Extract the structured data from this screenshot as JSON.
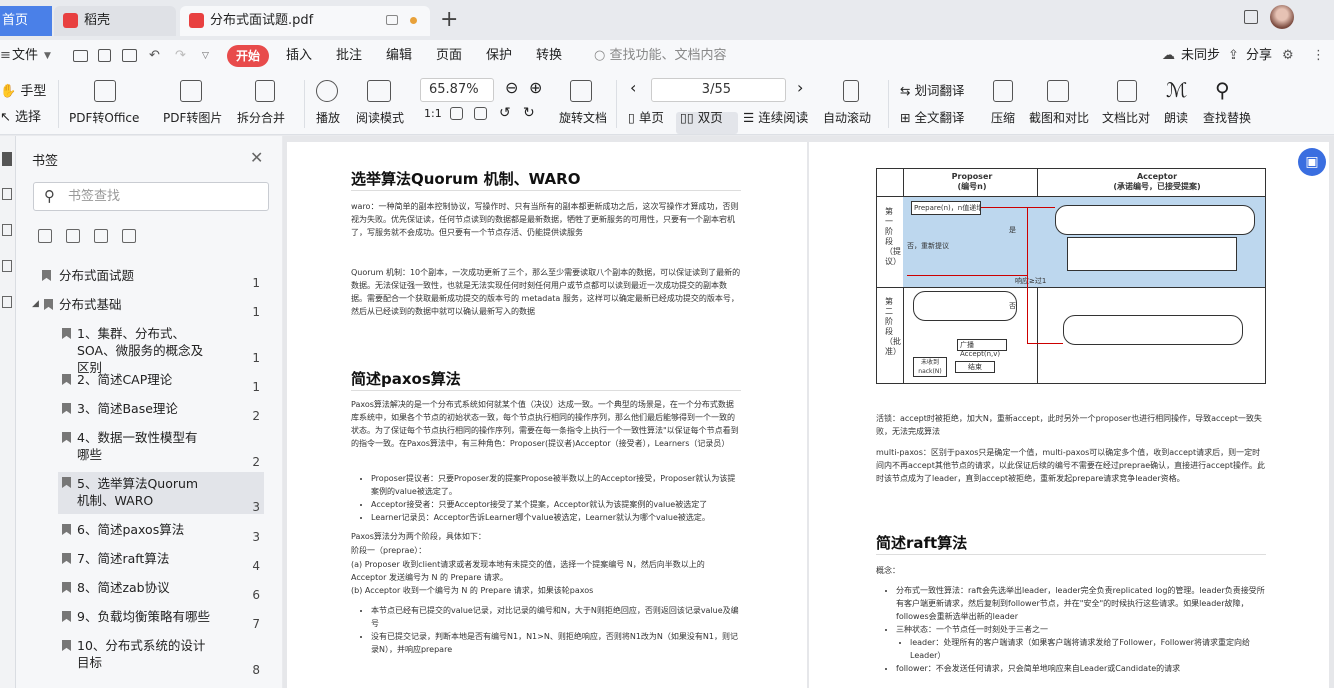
{
  "tabs": {
    "home": "首页",
    "daoke": "稻壳",
    "doc": "分布式面试题.pdf"
  },
  "menu": {
    "file": "文件",
    "start": "开始",
    "insert": "插入",
    "comment": "批注",
    "edit": "编辑",
    "page": "页面",
    "protect": "保护",
    "convert": "转换",
    "search": "查找功能、文档内容",
    "unsync": "未同步",
    "share": "分享"
  },
  "toolbar": {
    "hand": "手型",
    "select": "选择",
    "pdf2office": "PDF转Office",
    "pdf2img": "PDF转图片",
    "split": "拆分合并",
    "play": "播放",
    "readmode": "阅读模式",
    "zoom": "65.87%",
    "pageinfo": "3/55",
    "rotate": "旋转文档",
    "single": "单页",
    "dual": "双页",
    "continuous": "连续阅读",
    "autoscroll": "自动滚动",
    "wordtrans": "划词翻译",
    "fulltrans": "全文翻译",
    "compress": "压缩",
    "screenshot": "截图和对比",
    "compare": "文档比对",
    "read": "朗读",
    "findreplace": "查找替换"
  },
  "sidebar": {
    "title": "书签",
    "search_placeholder": "书签查找",
    "items": [
      {
        "label": "分布式面试题",
        "page": "1"
      },
      {
        "label": "分布式基础",
        "page": "1"
      },
      {
        "label": "1、集群、分布式、SOA、微服务的概念及区别",
        "page": "1"
      },
      {
        "label": "2、简述CAP理论",
        "page": "1"
      },
      {
        "label": "3、简述Base理论",
        "page": "2"
      },
      {
        "label": "4、数据一致性模型有哪些",
        "page": "2"
      },
      {
        "label": "5、选举算法Quorum机制、WARO",
        "page": "3"
      },
      {
        "label": "6、简述paxos算法",
        "page": "3"
      },
      {
        "label": "7、简述raft算法",
        "page": "4"
      },
      {
        "label": "8、简述zab协议",
        "page": "6"
      },
      {
        "label": "9、负载均衡策略有哪些",
        "page": "7"
      },
      {
        "label": "10、分布式系统的设计目标",
        "page": "8"
      }
    ]
  },
  "page1": {
    "h1": "选举算法Quorum 机制、WARO",
    "p1": "waro：一种简单的副本控制协议，写操作时、只有当所有的副本都更新成功之后，这次写操作才算成功，否则视为失败。优先保证读，任何节点读到的数据都是最新数据，牺牲了更新服务的可用性，只要有一个副本宕机了，写服务就不会成功。但只要有一个节点存活、仍能提供读服务",
    "p2": "Quorum 机制：10个副本，一次成功更新了三个，那么至少需要读取八个副本的数据，可以保证读到了最新的数据。无法保证强一致性，也就是无法实现任何时刻任何用户或节点都可以读到最近一次成功提交的副本数据。需要配合一个获取最新成功提交的版本号的 metadata 服务，这样可以确定最新已经成功提交的版本号，然后从已经读到的数据中就可以确认最新写入的数据",
    "h2": "简述paxos算法",
    "p3": "Paxos算法解决的是一个分布式系统如何就某个值（决议）达成一致。一个典型的场景是，在一个分布式数据库系统中，如果各个节点的初始状态一致，每个节点执行相同的操作序列，那么他们最后能够得到一个一致的状态。为了保证每个节点执行相同的操作序列，需要在每一条指令上执行一个一致性算法\"以保证每个节点看到的指令一致。在Paxos算法中，有三种角色：Proposer(提议者)Acceptor（接受者），Learners（记录员）",
    "li1": "Proposer提议者：只要Proposer发的提案Propose被半数以上的Acceptor接受，Proposer就认为该提案例的value被选定了。",
    "li2": "Acceptor接受者：只要Acceptor接受了某个提案，Acceptor就认为该提案例的value被选定了",
    "li3": "Learner记录员：Acceptor告诉Learner哪个value被选定，Learner就认为哪个value被选定。",
    "p4": "Paxos算法分为两个阶段，具体如下：",
    "p5": "阶段一（preprae）：",
    "p6": "(a) Proposer 收到client请求或者发现本地有未提交的值，选择一个提案编号 N，然后向半数以上的 Acceptor 发送编号为 N 的 Prepare 请求。",
    "p7": "(b) Acceptor 收到一个编号为 N 的 Prepare 请求，如果该轮paxos",
    "li4": "本节点已经有已提交的value记录，对比记录的编号和N，大于N则拒绝回应，否则返回该记录value及编号",
    "li5": "没有已提交记录，判断本地是否有编号N1，N1>N、则拒绝响应，否则将N1改为N（如果没有N1，则记录N），并响应prepare"
  },
  "page2": {
    "diagram": {
      "proposer": "Proposer",
      "proposer_sub": "(编号n)",
      "acceptor": "Acceptor",
      "acceptor_sub": "(承诺编号，已接受提案)",
      "phase1": "第一阶段（提议）",
      "phase2": "第二阶段（批准）",
      "n1": "Prepare(n)，n值递增，不能重复",
      "n2": "否，重新提议",
      "n3": "响应≥过1",
      "n4": "广播Accept(n,v)",
      "n5": "结束",
      "n6": "未收到nack(N)",
      "yes": "是",
      "no": "否"
    },
    "p1": "活锁：accept时被拒绝，加大N，重新accept，此时另外一个proposer也进行相同操作，导致accept一致失败，无法完成算法",
    "p2": "multi-paxos：区别于paxos只是确定一个值，multi-paxos可以确定多个值，收到accept请求后，则一定时间内不再accept其他节点的请求，以此保证后续的编号不需要在经过preprae确认，直接进行accept操作。此时该节点成为了leader，直到accept被拒绝，重新发起prepare请求竞争leader资格。",
    "h1": "简述raft算法",
    "p3": "概念：",
    "li1": "分布式一致性算法：raft会先选举出leader，leader完全负责replicated log的管理。leader负责接受所有客户端更新请求，然后复制到follower节点，并在\"安全\"的时候执行这些请求。如果leader故障，followes会重新选举出新的leader",
    "li2": "三种状态：一个节点任一时刻处于三者之一",
    "li3": "leader：处理所有的客户端请求（如果客户端将请求发给了Follower，Follower将请求重定向给Leader）",
    "li4": "follower：不会发送任何请求，只会简单地响应来自Leader或Candidate的请求"
  }
}
